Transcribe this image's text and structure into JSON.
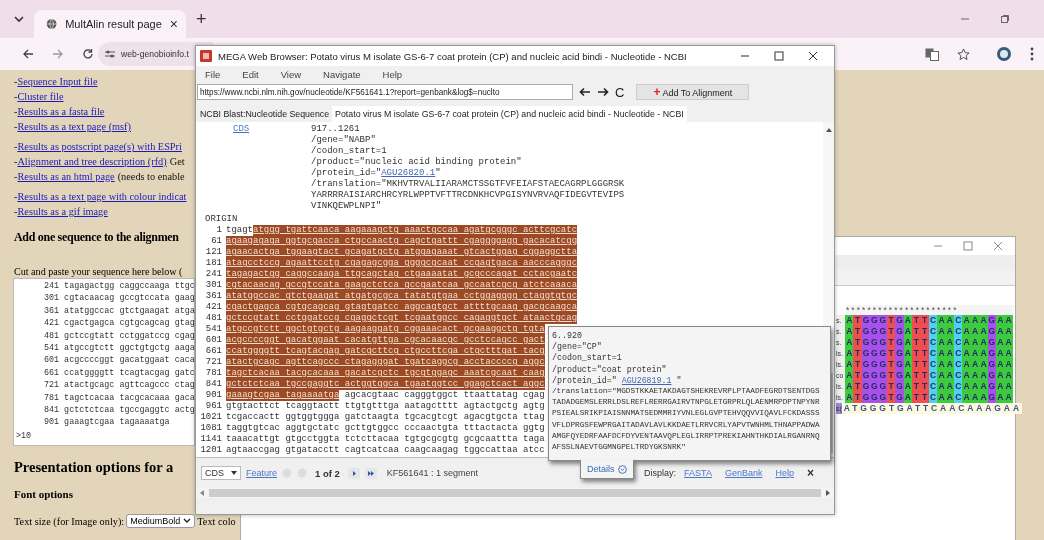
{
  "browser": {
    "tab": {
      "title": "MultAlin result page",
      "close": "×"
    },
    "new_tab": "+",
    "address": "web-genobioinfo.t"
  },
  "page": {
    "link_groups": [
      [
        {
          "prefix": "-",
          "link": "Sequence Input file"
        },
        {
          "prefix": "-",
          "link": "Cluster file"
        },
        {
          "prefix": "-",
          "link": "Results as a fasta file"
        },
        {
          "prefix": "-",
          "link": "Results as a text page (msf)"
        }
      ],
      [
        {
          "prefix": "-",
          "link": "Results as postscript page(s) with ESPri"
        },
        {
          "prefix": "-",
          "link": "Alignment and tree description (rfd)",
          "after": "Get"
        },
        {
          "prefix": "-",
          "link": "Results as an html page",
          "after": "(needs to enable"
        }
      ],
      [
        {
          "prefix": "-",
          "link": "Results as a text page with colour indicat"
        },
        {
          "prefix": "-",
          "link": "Results as a gif image"
        }
      ]
    ],
    "add_heading": "Add one sequence to the alignmen",
    "paste_label": "Cut and paste your sequence here below (",
    "sequence_box": [
      "241 tagagactgg caggccaaga ttgc",
      "301 cgtacaacag gccgtccata gaag",
      "361 atatggccac gtctgaagat atga",
      "421 cgactgagca cgtgcagcag gtag",
      "481 gctccgtatt cctggatccg cgag",
      "541 atgccgtctt ggctgtgctg aaga",
      "601 acgccccggt gacatggaat caca",
      "661 ccatggggtt tcagtacgag gatc",
      "721 atactgcagc agttcagccc ctag",
      "781 tagctcacaa tacgcacaaa gaca",
      "841 gctctctcaa tgccgaggtc actg",
      "901 gaaagtcgaa tagaaaatga"
    ],
    "sequence_box_header": ">10",
    "options_heading": "Presentation options for a",
    "font_heading": "Font options",
    "text_size_label": "Text size (for Image only):",
    "text_size_value": "MediumBold",
    "text_color_label": "Text colo"
  },
  "mega": {
    "title": "MEGA Web Browser: Potato virus M isolate GS-6-7 coat protein (CP) and nucleic acid bindi - Nucleotide - NCBI",
    "menu": [
      "File",
      "Edit",
      "View",
      "Navigate",
      "Help"
    ],
    "url": "https://www.ncbi.nlm.nih.gov/nucleotide/KF561641.1?report=genbank&log$=nuclto",
    "reload": "C",
    "add_button": {
      "icon": "+",
      "label": "Add To Alignment"
    },
    "tabs": [
      {
        "label": "NCBI Blast:Nucleotide Sequence",
        "selected": false
      },
      {
        "label": "Potato virus M isolate GS-6-7 coat protein (CP) and nucleic acid bindi - Nucleotide - NCBI",
        "selected": true
      }
    ],
    "feature": {
      "key": "CDS",
      "lines": [
        {
          "text": "917..1261"
        },
        {
          "text": "/gene=\"NABP\""
        },
        {
          "text": "/codon_start=1"
        },
        {
          "text": "/product=\"nucleic acid binding protein\""
        },
        {
          "text": "/protein_id=\"",
          "link": "AGU26820.1",
          "after": "\""
        },
        {
          "text": "/translation=\"MKHVTRVALIIARAMCTSSGTFVFEIAFSTAECAGRPLGGGRSK"
        },
        {
          "text": "YARRRRAISIARCHRCYRLWPPTVFTTRCDNKHCVPGISYNVRVAQFIDEGVTEVIPS"
        },
        {
          "text": "VINKQEWPLNPI\""
        }
      ]
    },
    "origin_label": "ORIGIN",
    "sequence": [
      {
        "number": "1",
        "segments": [
          {
            "text": "tgagt",
            "highlighted": false
          },
          {
            "text": "atggg tgattcaaca aagaaagctg aaactgccaa agatgcgggc acttcgcatc",
            "highlighted": true
          }
        ]
      },
      {
        "number": "61",
        "segments": [
          {
            "text": "agaagagaga ggtgcgacca ctgccaactg cagctgattt cgaggggagg gacacatcgg",
            "highlighted": true
          }
        ]
      },
      {
        "number": "121",
        "segments": [
          {
            "text": "agaacactga tggaagtact gcagatgctg atggagaaat gtcactggag cggaggctta",
            "highlighted": true
          }
        ]
      },
      {
        "number": "181",
        "segments": [
          {
            "text": "atagcctccg agaattcctg cgagagcgga ggggcgcaat ccgagtgaca aacccagggc",
            "highlighted": true
          }
        ]
      },
      {
        "number": "241",
        "segments": [
          {
            "text": "tagagactgg caggccaaga ttgcagctag ctgaaaatat gcgcccagat cctacgaatc",
            "highlighted": true
          }
        ]
      },
      {
        "number": "301",
        "segments": [
          {
            "text": "cgtacaacag gccgtccata gaagctctca gccgaatcaa gccaatcgcg atctcaaaca",
            "highlighted": true
          }
        ]
      },
      {
        "number": "361",
        "segments": [
          {
            "text": "atatggccac gtctgaagat atgatgcgca tatatgtgaa cctggagggg ctaggtgtgc",
            "highlighted": true
          }
        ]
      },
      {
        "number": "421",
        "segments": [
          {
            "text": "cgactgagca cgtgcagcag gtagtgatcc aggcagtgct attttgcaag gacgcaagca",
            "highlighted": true
          }
        ]
      },
      {
        "number": "481",
        "segments": [
          {
            "text": "gctccgtatt cctggatccg cgaggctcgt tcgaatggcc cagaggtgct ataactgcag",
            "highlighted": true
          }
        ]
      },
      {
        "number": "541",
        "segments": [
          {
            "text": "atgccgtctt ggctgtgctg aagaaggatg cggaaacact gcgaaggctg tgta",
            "highlighted": true
          }
        ]
      },
      {
        "number": "601",
        "segments": [
          {
            "text": "acgccccggt gacatggaat cacatgttga cgcacaacgc gcctccagcc gact",
            "highlighted": true
          }
        ]
      },
      {
        "number": "661",
        "segments": [
          {
            "text": "ccatggggtt tcagtacgag gatcgcttcg ctgccttcga ctgctttgat tacg",
            "highlighted": true
          }
        ]
      },
      {
        "number": "721",
        "segments": [
          {
            "text": "atactgcagc agttcagccc ctagagggat tgatcaggcg acctaccccg aggc",
            "highlighted": true
          }
        ]
      },
      {
        "number": "781",
        "segments": [
          {
            "text": "tagctcacaa tacgcacaaa gacatcgctc tgcgtggagc aaatcgcaat caag",
            "highlighted": true
          }
        ]
      },
      {
        "number": "841",
        "segments": [
          {
            "text": "gctctctcaa tgccgaggtc actggtggca tgaatggtcc ggagctcact aggc",
            "highlighted": true
          }
        ]
      },
      {
        "number": "901",
        "segments": [
          {
            "text": "gaaagtcgaa tagaaaatga",
            "highlighted": true
          },
          {
            "text": " agcacgtaac cagggtggct ttaattatag cgag",
            "highlighted": false
          }
        ]
      },
      {
        "number": "961",
        "segments": [
          {
            "text": "gtgtacttct tcaggtactt ttgtgtttga aatagctttt agtactgctg agtg",
            "highlighted": false
          }
        ]
      },
      {
        "number": "1021",
        "segments": [
          {
            "text": "tcgaccactt ggtggtggga gatctaagta tgcacgtcgt agacgtgcta ttag",
            "highlighted": false
          }
        ]
      },
      {
        "number": "1081",
        "segments": [
          {
            "text": "taggtgtcac aggtgctatc gcttgtggcc cccaactgta tttactacta ggtg",
            "highlighted": false
          }
        ]
      },
      {
        "number": "1141",
        "segments": [
          {
            "text": "taaacattgt gtgcctggta tctcttacaa tgtgcgcgtg gcgcaattta taga",
            "highlighted": false
          }
        ]
      },
      {
        "number": "1201",
        "segments": [
          {
            "text": "agtaaccgag gtgatacctt cagtcatcaa caagcaagag tggccattaa atcc",
            "highlighted": false
          }
        ]
      }
    ],
    "popup": {
      "lines": [
        {
          "text": "6..920"
        },
        {
          "text": "/gene=\"CP\""
        },
        {
          "text": "/codon_start=1"
        },
        {
          "text": "/product=\"coat protein\""
        },
        {
          "text": "/protein_id=\" ",
          "link": "AGU26819.1",
          "after": " \""
        },
        {
          "text": "/translation=\"MGDSTKKAETAKDAGTSHEKREVRPLPTAADFEGRDTSENTDGS"
        },
        {
          "text": "TADADGEMSLERRLDSLREFLRERRGAIRVTNPGLETGRPRLQLAENMRPDPTNPYNR"
        },
        {
          "text": "PSIEALSRIKPIAISNNMATSEDMMRIYVNLEGLGVPTEHVQQVVIQAVLFCKDASSS"
        },
        {
          "text": "VFLDPRGSFEWPRGAITADAVLAVLKKDAETLRRVCRLYAPVTWNHMLTHNAPPADWA"
        },
        {
          "text": "AMGFQYEDRFAAFDCFDYVENTAAVQPLEGLIRRPTPREKIAHNTHKDIALRGANRNQ"
        },
        {
          "text": "AFSSLNAEVTGGMNGPELTRDYGKSNRK\""
        }
      ],
      "details": "Details"
    },
    "bottom_bar": {
      "select": "CDS",
      "feature_link": "Feature",
      "pager": "1 of 2",
      "segment_info": "KF561641 : 1 segment",
      "display_label": "Display:",
      "links": [
        "FASTA",
        "GenBank",
        "Help"
      ],
      "close": "×"
    }
  },
  "alignment": {
    "marks": "*********************",
    "rows": [
      {
        "label": "s.",
        "kind": "colored",
        "bases": [
          {
            "base": "A",
            "color": "#3ccb3c"
          },
          {
            "base": "T",
            "color": "#ef4f4f"
          },
          {
            "base": "G",
            "color": "#a652ea"
          },
          {
            "base": "G",
            "color": "#a652ea"
          },
          {
            "base": "G",
            "color": "#a652ea"
          },
          {
            "base": "T",
            "color": "#ef4f4f"
          },
          {
            "base": "G",
            "color": "#a652ea"
          },
          {
            "base": "A",
            "color": "#3ccb3c"
          },
          {
            "base": "T",
            "color": "#ef4f4f"
          },
          {
            "base": "T",
            "color": "#ef4f4f"
          },
          {
            "base": "C",
            "color": "#4fd2f0"
          },
          {
            "base": "A",
            "color": "#3ccb3c"
          },
          {
            "base": "A",
            "color": "#3ccb3c"
          },
          {
            "base": "C",
            "color": "#4fd2f0"
          },
          {
            "base": "A",
            "color": "#3ccb3c"
          },
          {
            "base": "A",
            "color": "#3ccb3c"
          },
          {
            "base": "A",
            "color": "#3ccb3c"
          },
          {
            "base": "G",
            "color": "#a652ea"
          },
          {
            "base": "A",
            "color": "#3ccb3c"
          },
          {
            "base": "A",
            "color": "#3ccb3c"
          }
        ]
      },
      {
        "label": "s.",
        "kind": "colored",
        "bases": [
          {
            "base": "A",
            "color": "#3ccb3c"
          },
          {
            "base": "T",
            "color": "#ef4f4f"
          },
          {
            "base": "G",
            "color": "#a652ea"
          },
          {
            "base": "G",
            "color": "#a652ea"
          },
          {
            "base": "G",
            "color": "#a652ea"
          },
          {
            "base": "T",
            "color": "#ef4f4f"
          },
          {
            "base": "G",
            "color": "#a652ea"
          },
          {
            "base": "A",
            "color": "#3ccb3c"
          },
          {
            "base": "T",
            "color": "#ef4f4f"
          },
          {
            "base": "T",
            "color": "#ef4f4f"
          },
          {
            "base": "C",
            "color": "#4fd2f0"
          },
          {
            "base": "A",
            "color": "#3ccb3c"
          },
          {
            "base": "A",
            "color": "#3ccb3c"
          },
          {
            "base": "C",
            "color": "#4fd2f0"
          },
          {
            "base": "A",
            "color": "#3ccb3c"
          },
          {
            "base": "A",
            "color": "#3ccb3c"
          },
          {
            "base": "A",
            "color": "#3ccb3c"
          },
          {
            "base": "G",
            "color": "#a652ea"
          },
          {
            "base": "A",
            "color": "#3ccb3c"
          },
          {
            "base": "A",
            "color": "#3ccb3c"
          }
        ]
      },
      {
        "label": "s.",
        "kind": "colored",
        "bases": [
          {
            "base": "A",
            "color": "#3ccb3c"
          },
          {
            "base": "T",
            "color": "#ef4f4f"
          },
          {
            "base": "G",
            "color": "#a652ea"
          },
          {
            "base": "G",
            "color": "#a652ea"
          },
          {
            "base": "G",
            "color": "#a652ea"
          },
          {
            "base": "T",
            "color": "#ef4f4f"
          },
          {
            "base": "G",
            "color": "#a652ea"
          },
          {
            "base": "A",
            "color": "#3ccb3c"
          },
          {
            "base": "T",
            "color": "#ef4f4f"
          },
          {
            "base": "T",
            "color": "#ef4f4f"
          },
          {
            "base": "C",
            "color": "#4fd2f0"
          },
          {
            "base": "A",
            "color": "#3ccb3c"
          },
          {
            "base": "A",
            "color": "#3ccb3c"
          },
          {
            "base": "C",
            "color": "#4fd2f0"
          },
          {
            "base": "A",
            "color": "#3ccb3c"
          },
          {
            "base": "A",
            "color": "#3ccb3c"
          },
          {
            "base": "A",
            "color": "#3ccb3c"
          },
          {
            "base": "G",
            "color": "#a652ea"
          },
          {
            "base": "A",
            "color": "#3ccb3c"
          },
          {
            "base": "A",
            "color": "#3ccb3c"
          }
        ]
      },
      {
        "label": "ls.",
        "kind": "colored",
        "bases": [
          {
            "base": "A",
            "color": "#3ccb3c"
          },
          {
            "base": "T",
            "color": "#ef4f4f"
          },
          {
            "base": "G",
            "color": "#a652ea"
          },
          {
            "base": "G",
            "color": "#a652ea"
          },
          {
            "base": "G",
            "color": "#a652ea"
          },
          {
            "base": "T",
            "color": "#ef4f4f"
          },
          {
            "base": "G",
            "color": "#a652ea"
          },
          {
            "base": "A",
            "color": "#3ccb3c"
          },
          {
            "base": "T",
            "color": "#ef4f4f"
          },
          {
            "base": "T",
            "color": "#ef4f4f"
          },
          {
            "base": "C",
            "color": "#4fd2f0"
          },
          {
            "base": "A",
            "color": "#3ccb3c"
          },
          {
            "base": "A",
            "color": "#3ccb3c"
          },
          {
            "base": "C",
            "color": "#4fd2f0"
          },
          {
            "base": "A",
            "color": "#3ccb3c"
          },
          {
            "base": "A",
            "color": "#3ccb3c"
          },
          {
            "base": "A",
            "color": "#3ccb3c"
          },
          {
            "base": "G",
            "color": "#a652ea"
          },
          {
            "base": "A",
            "color": "#3ccb3c"
          },
          {
            "base": "A",
            "color": "#3ccb3c"
          }
        ]
      },
      {
        "label": "ls.",
        "kind": "colored",
        "bases": [
          {
            "base": "A",
            "color": "#3ccb3c"
          },
          {
            "base": "T",
            "color": "#ef4f4f"
          },
          {
            "base": "G",
            "color": "#a652ea"
          },
          {
            "base": "G",
            "color": "#a652ea"
          },
          {
            "base": "G",
            "color": "#a652ea"
          },
          {
            "base": "T",
            "color": "#ef4f4f"
          },
          {
            "base": "G",
            "color": "#a652ea"
          },
          {
            "base": "A",
            "color": "#3ccb3c"
          },
          {
            "base": "T",
            "color": "#ef4f4f"
          },
          {
            "base": "T",
            "color": "#ef4f4f"
          },
          {
            "base": "C",
            "color": "#4fd2f0"
          },
          {
            "base": "A",
            "color": "#3ccb3c"
          },
          {
            "base": "A",
            "color": "#3ccb3c"
          },
          {
            "base": "C",
            "color": "#4fd2f0"
          },
          {
            "base": "A",
            "color": "#3ccb3c"
          },
          {
            "base": "A",
            "color": "#3ccb3c"
          },
          {
            "base": "A",
            "color": "#3ccb3c"
          },
          {
            "base": "G",
            "color": "#a652ea"
          },
          {
            "base": "A",
            "color": "#3ccb3c"
          },
          {
            "base": "A",
            "color": "#3ccb3c"
          }
        ]
      },
      {
        "label": "co",
        "kind": "colored",
        "bases": [
          {
            "base": "A",
            "color": "#3ccb3c"
          },
          {
            "base": "T",
            "color": "#ef4f4f"
          },
          {
            "base": "G",
            "color": "#a652ea"
          },
          {
            "base": "G",
            "color": "#a652ea"
          },
          {
            "base": "G",
            "color": "#a652ea"
          },
          {
            "base": "T",
            "color": "#ef4f4f"
          },
          {
            "base": "G",
            "color": "#a652ea"
          },
          {
            "base": "A",
            "color": "#3ccb3c"
          },
          {
            "base": "T",
            "color": "#ef4f4f"
          },
          {
            "base": "T",
            "color": "#ef4f4f"
          },
          {
            "base": "C",
            "color": "#4fd2f0"
          },
          {
            "base": "A",
            "color": "#3ccb3c"
          },
          {
            "base": "A",
            "color": "#3ccb3c"
          },
          {
            "base": "C",
            "color": "#4fd2f0"
          },
          {
            "base": "A",
            "color": "#3ccb3c"
          },
          {
            "base": "A",
            "color": "#3ccb3c"
          },
          {
            "base": "A",
            "color": "#3ccb3c"
          },
          {
            "base": "G",
            "color": "#a652ea"
          },
          {
            "base": "A",
            "color": "#3ccb3c"
          },
          {
            "base": "A",
            "color": "#3ccb3c"
          }
        ]
      },
      {
        "label": "ls.",
        "kind": "colored",
        "bases": [
          {
            "base": "A",
            "color": "#3ccb3c"
          },
          {
            "base": "T",
            "color": "#ef4f4f"
          },
          {
            "base": "G",
            "color": "#a652ea"
          },
          {
            "base": "G",
            "color": "#a652ea"
          },
          {
            "base": "G",
            "color": "#a652ea"
          },
          {
            "base": "T",
            "color": "#ef4f4f"
          },
          {
            "base": "G",
            "color": "#a652ea"
          },
          {
            "base": "A",
            "color": "#3ccb3c"
          },
          {
            "base": "T",
            "color": "#ef4f4f"
          },
          {
            "base": "T",
            "color": "#ef4f4f"
          },
          {
            "base": "C",
            "color": "#4fd2f0"
          },
          {
            "base": "A",
            "color": "#3ccb3c"
          },
          {
            "base": "A",
            "color": "#3ccb3c"
          },
          {
            "base": "C",
            "color": "#4fd2f0"
          },
          {
            "base": "A",
            "color": "#3ccb3c"
          },
          {
            "base": "A",
            "color": "#3ccb3c"
          },
          {
            "base": "A",
            "color": "#3ccb3c"
          },
          {
            "base": "G",
            "color": "#a652ea"
          },
          {
            "base": "A",
            "color": "#3ccb3c"
          },
          {
            "base": "A",
            "color": "#3ccb3c"
          }
        ]
      },
      {
        "label": "ls.",
        "kind": "colored",
        "bases": [
          {
            "base": "A",
            "color": "#3ccb3c"
          },
          {
            "base": "T",
            "color": "#ef4f4f"
          },
          {
            "base": "G",
            "color": "#a652ea"
          },
          {
            "base": "G",
            "color": "#a652ea"
          },
          {
            "base": "G",
            "color": "#a652ea"
          },
          {
            "base": "T",
            "color": "#ef4f4f"
          },
          {
            "base": "G",
            "color": "#a652ea"
          },
          {
            "base": "A",
            "color": "#3ccb3c"
          },
          {
            "base": "T",
            "color": "#ef4f4f"
          },
          {
            "base": "T",
            "color": "#ef4f4f"
          },
          {
            "base": "C",
            "color": "#4fd2f0"
          },
          {
            "base": "A",
            "color": "#3ccb3c"
          },
          {
            "base": "A",
            "color": "#3ccb3c"
          },
          {
            "base": "C",
            "color": "#4fd2f0"
          },
          {
            "base": "A",
            "color": "#3ccb3c"
          },
          {
            "base": "A",
            "color": "#3ccb3c"
          },
          {
            "base": "A",
            "color": "#3ccb3c"
          },
          {
            "base": "G",
            "color": "#a652ea"
          },
          {
            "base": "A",
            "color": "#3ccb3c"
          },
          {
            "base": "A",
            "color": "#3ccb3c"
          }
        ]
      },
      {
        "label": "s(",
        "kind": "plain",
        "sequence": "ATGGGTGATTCAACAAAGAA"
      }
    ]
  }
}
